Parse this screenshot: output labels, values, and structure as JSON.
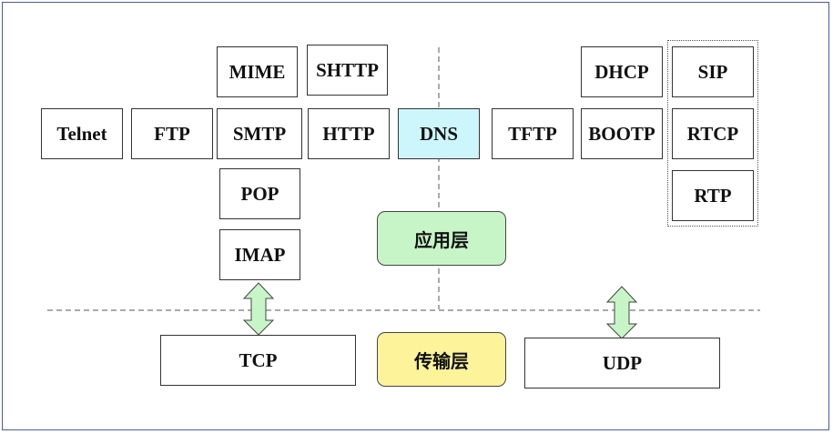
{
  "application_protocols": {
    "telnet": "Telnet",
    "ftp": "FTP",
    "mime": "MIME",
    "smtp": "SMTP",
    "pop": "POP",
    "imap": "IMAP",
    "shttp": "SHTTP",
    "http": "HTTP",
    "dns": "DNS",
    "tftp": "TFTP",
    "dhcp": "DHCP",
    "bootp": "BOOTP",
    "sip": "SIP",
    "rtcp": "RTCP",
    "rtp": "RTP"
  },
  "transport_protocols": {
    "tcp": "TCP",
    "udp": "UDP"
  },
  "layers": {
    "application": "应用层",
    "transport": "传输层"
  },
  "colors": {
    "dns_fill": "#ccf6fb",
    "application_layer_fill": "#c8f5c8",
    "transport_layer_fill": "#fcf39a",
    "arrow_fill": "#c8f5c8",
    "frame_border": "#4a5aa8"
  }
}
